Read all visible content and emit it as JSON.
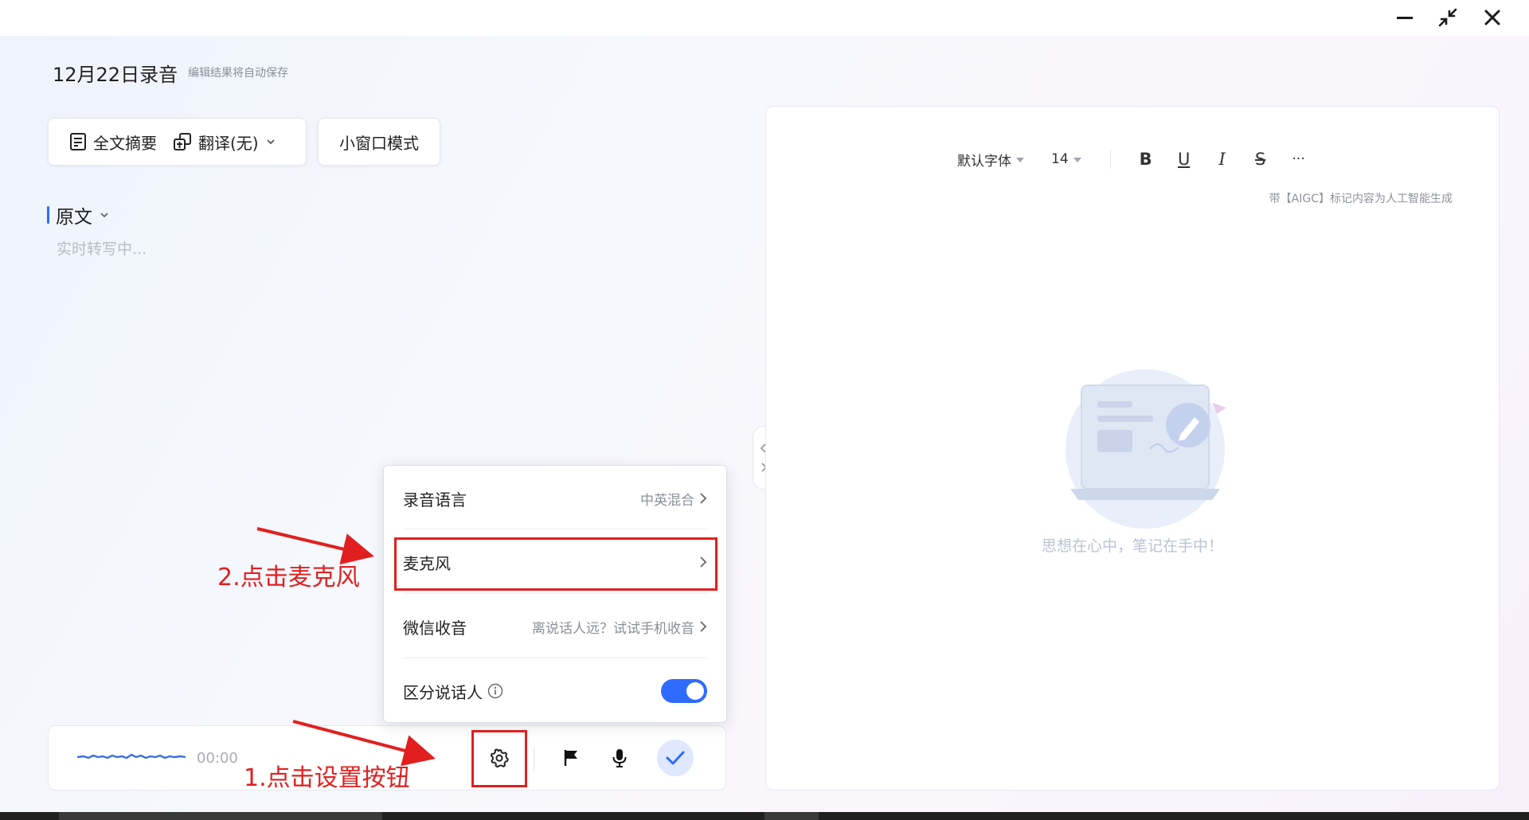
{
  "window": {
    "minimize_label": "minimize",
    "restore_label": "restore",
    "close_label": "close"
  },
  "header": {
    "title": "12月22日录音",
    "subtitle": "编辑结果将自动保存"
  },
  "toolbar": {
    "summary_label": "全文摘要",
    "translate_label": "翻译(无)",
    "mini_window_label": "小窗口模式"
  },
  "transcript": {
    "section_title": "原文",
    "placeholder": "实时转写中..."
  },
  "editor": {
    "font_family": "默认字体",
    "font_size": "14",
    "bold": "B",
    "underline": "U",
    "italic": "I",
    "strike": "S",
    "more": "···",
    "aigc_note": "带【AIGC】标记内容为人工智能生成",
    "empty_text": "思想在心中，笔记在手中！"
  },
  "recorder": {
    "timer": "00:00"
  },
  "settings_menu": {
    "items": [
      {
        "label": "录音语言",
        "value": "中英混合"
      },
      {
        "label": "麦克风",
        "value": ""
      },
      {
        "label": "微信收音",
        "value": "离说话人远？试试手机收音"
      },
      {
        "label": "区分说话人",
        "toggle_on": true
      }
    ]
  },
  "annotations": {
    "step1": "1.点击设置按钮",
    "step2": "2.点击麦克风",
    "color": "#e11f1f"
  },
  "colors": {
    "accent": "#2f6bff",
    "annotation": "#e11f1f"
  }
}
